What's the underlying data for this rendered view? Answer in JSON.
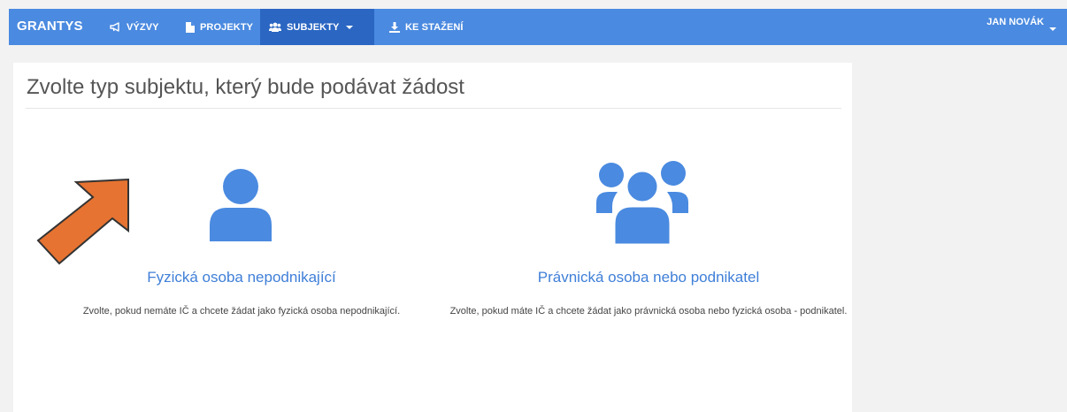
{
  "navbar": {
    "brand": "GRANTYS",
    "items": [
      {
        "label": "VÝZVY",
        "icon": "bullhorn-icon"
      },
      {
        "label": "PROJEKTY",
        "icon": "file-icon"
      },
      {
        "label": "SUBJEKTY",
        "icon": "users-icon",
        "active": true,
        "dropdown": true
      },
      {
        "label": "KE STAŽENÍ",
        "icon": "download-icon"
      }
    ],
    "user": "JAN NOVÁK"
  },
  "main": {
    "title": "Zvolte typ subjektu, který bude podávat žádost",
    "options": [
      {
        "label": "Fyzická osoba nepodnikající",
        "description": "Zvolte, pokud nemáte IČ a chcete žádat jako fyzická osoba nepodnikající.",
        "icon": "user-icon"
      },
      {
        "label": "Právnická osoba nebo podnikatel",
        "description": "Zvolte, pokud máte IČ a chcete žádat jako právnická osoba nebo fyzická osoba - podnikatel.",
        "icon": "users-icon"
      }
    ]
  },
  "colors": {
    "navbar": "#4a8ae0",
    "navbar_active": "#2a66c2",
    "link": "#3f7fd8",
    "icon": "#4a8ae0",
    "arrow": "#e67331"
  }
}
